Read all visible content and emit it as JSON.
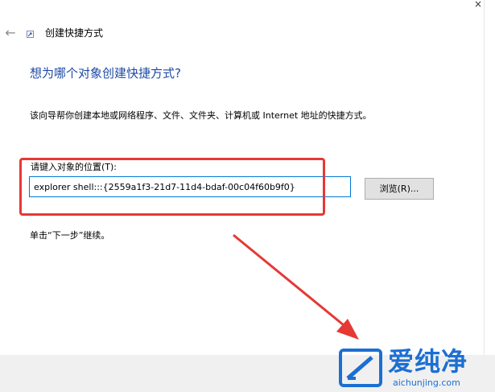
{
  "window": {
    "title": "创建快捷方式",
    "back_label": "←",
    "close_label": "×"
  },
  "main": {
    "heading": "想为哪个对象创建快捷方式?",
    "description": "该向导帮你创建本地或网络程序、文件、文件夹、计算机或 Internet 地址的快捷方式。",
    "location_label": "请键入对象的位置(T):",
    "location_value": "explorer shell:::{2559a1f3-21d7-11d4-bdaf-00c04f60b9f0}",
    "browse_label": "浏览(R)...",
    "hint": "单击“下一步”继续。"
  },
  "annotations": {
    "highlight_color": "#e53935",
    "arrow_color": "#e53935"
  },
  "watermark": {
    "brand": "爱纯净",
    "url": "aichunjing.com",
    "color": "#1c6fd2"
  }
}
